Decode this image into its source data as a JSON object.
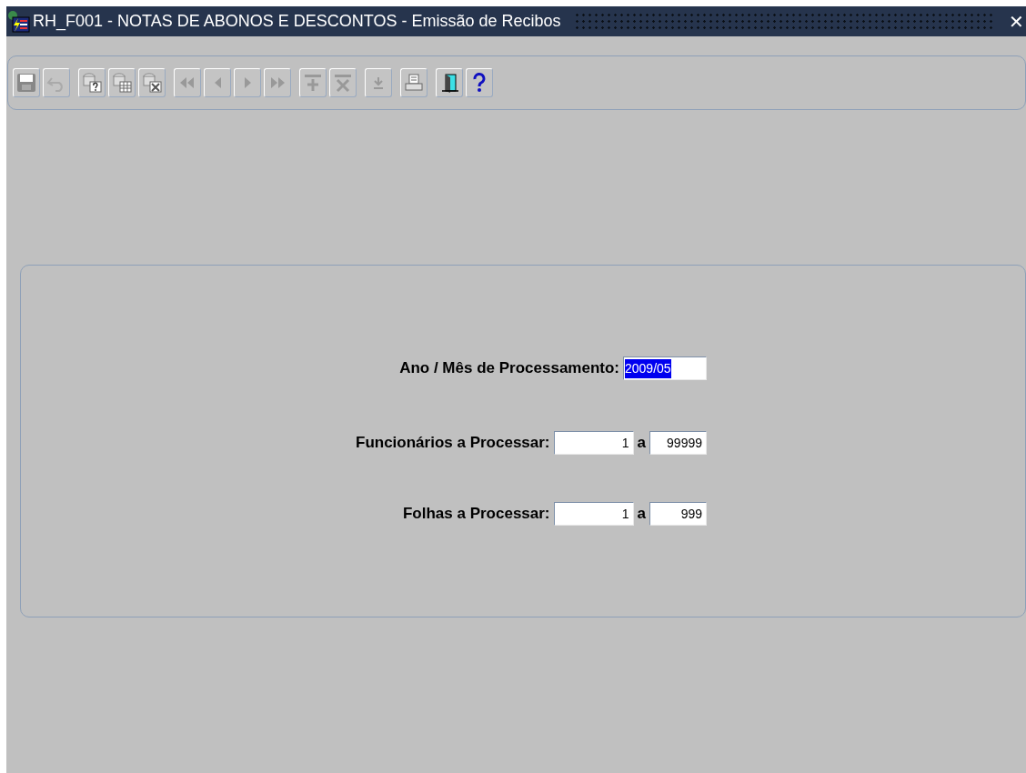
{
  "window": {
    "title": "RH_F001 - NOTAS DE ABONOS E DESCONTOS - Emissão de Recibos",
    "close": "✕"
  },
  "toolbar": [
    {
      "kind": "save"
    },
    {
      "kind": "undo"
    },
    {
      "kind": "query"
    },
    {
      "kind": "query-table"
    },
    {
      "kind": "query-delete"
    },
    {
      "kind": "first"
    },
    {
      "kind": "prev"
    },
    {
      "kind": "next"
    },
    {
      "kind": "last"
    },
    {
      "kind": "insert"
    },
    {
      "kind": "delete"
    },
    {
      "kind": "download"
    },
    {
      "kind": "print"
    },
    {
      "kind": "exit"
    },
    {
      "kind": "help"
    }
  ],
  "form": [
    {
      "label": "Ano / Mês de Processamento:",
      "fields": [
        {
          "value": "2009/05",
          "selected": true
        }
      ]
    },
    {
      "label": "Funcionários a Processar:",
      "fields": [
        {
          "value": "1",
          "selected": false
        },
        {
          "value": "99999",
          "selected": false
        }
      ],
      "separator": "a"
    },
    {
      "label": "Folhas a Processar:",
      "fields": [
        {
          "value": "1",
          "selected": false
        },
        {
          "value": "999",
          "selected": false
        }
      ],
      "separator": "a"
    }
  ]
}
